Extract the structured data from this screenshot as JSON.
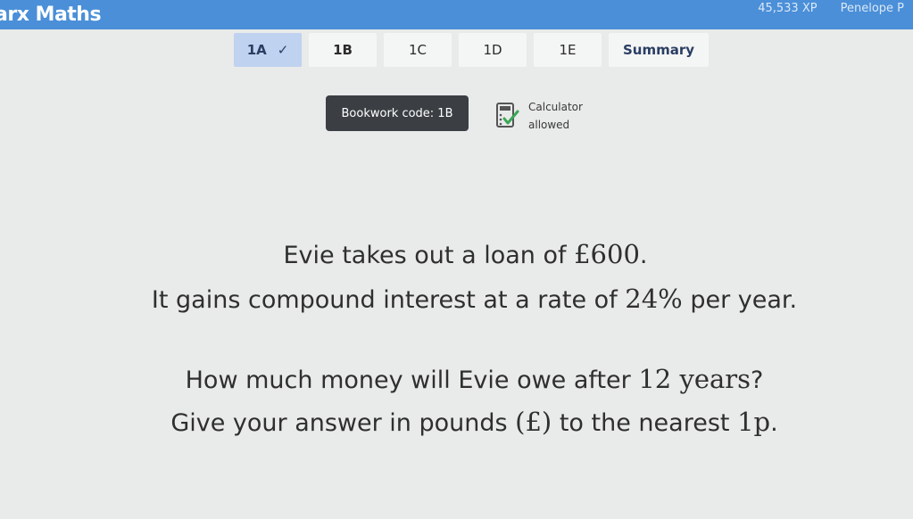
{
  "header": {
    "app_title": "arx Maths",
    "xp": "45,533 XP",
    "user": "Penelope P"
  },
  "tabs": [
    {
      "label": "1A",
      "completed": true
    },
    {
      "label": "1B",
      "active": true
    },
    {
      "label": "1C"
    },
    {
      "label": "1D"
    },
    {
      "label": "1E"
    },
    {
      "label": "Summary"
    }
  ],
  "bookwork": {
    "label": "Bookwork code: 1B"
  },
  "calculator": {
    "line1": "Calculator",
    "line2": "allowed",
    "icon": "calculator-check-icon"
  },
  "question": {
    "line1_pre": "Evie takes out a loan of ",
    "line1_math": "£600",
    "line1_post": ".",
    "line2_pre": "It gains compound interest at a rate of ",
    "line2_math": "24%",
    "line2_post": " per year.",
    "line3_pre": "How much money will Evie owe after ",
    "line3_math": "12 years",
    "line3_post": "?",
    "line4_pre": "Give your answer in pounds ",
    "line4_math": "(£)",
    "line4_mid": " to the nearest ",
    "line4_math2": "1p",
    "line4_post": "."
  },
  "colors": {
    "topbar": "#4a8fd8",
    "tab_completed": "#bfd2ef",
    "bookwork_bg": "#3b3f44",
    "check_green": "#3aa856"
  }
}
